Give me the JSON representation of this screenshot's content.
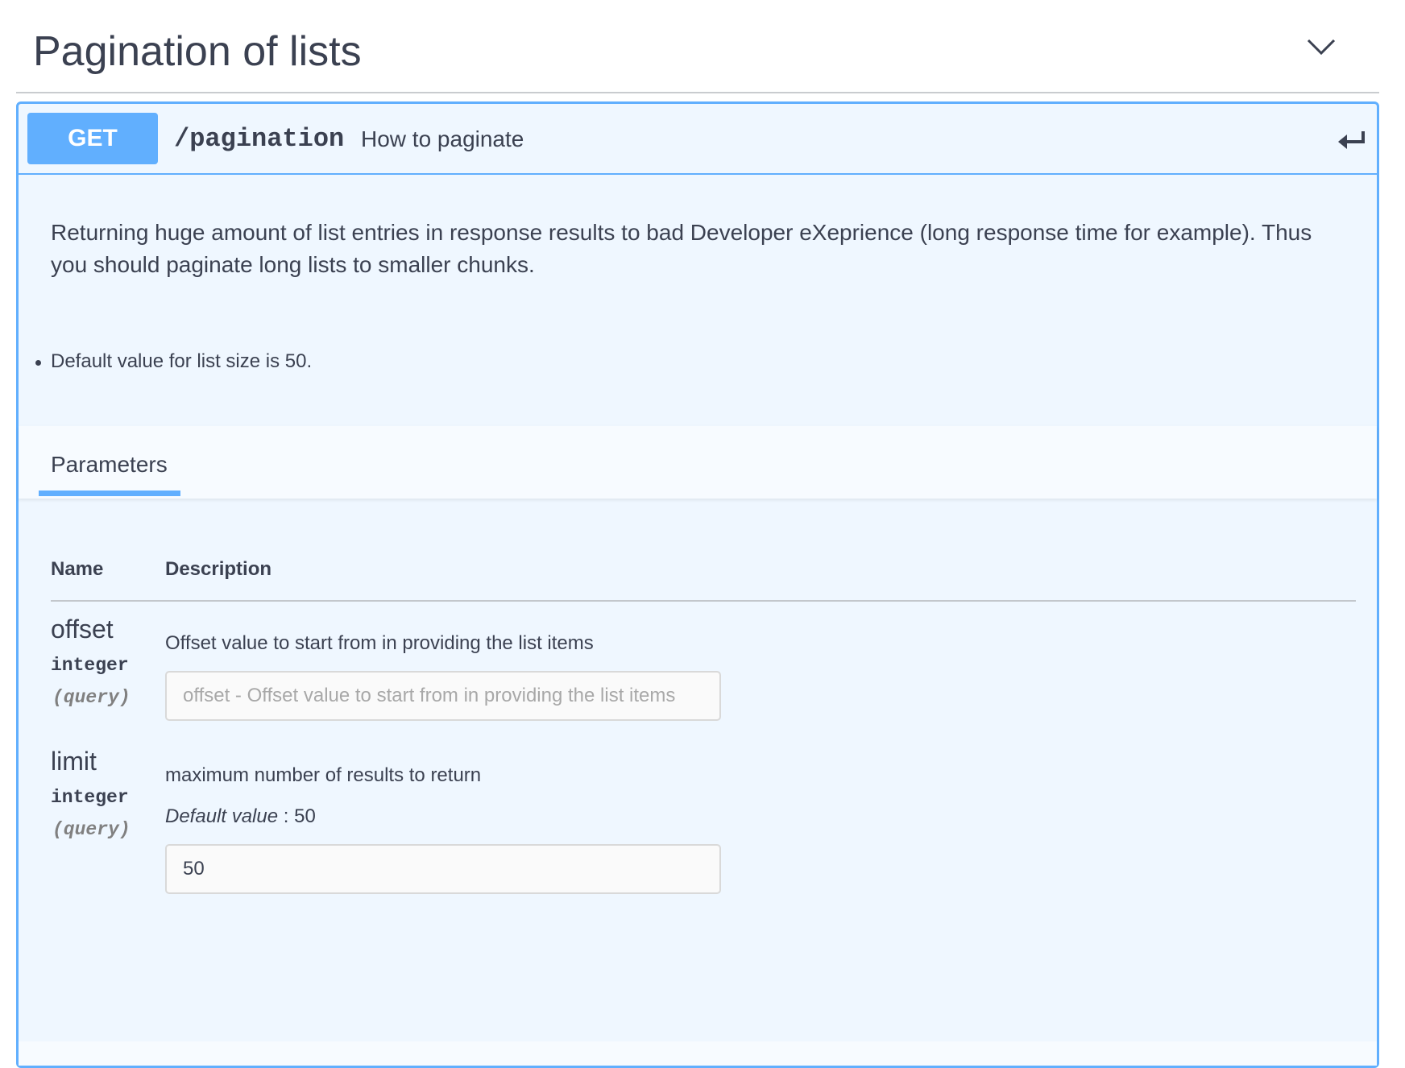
{
  "section": {
    "title": "Pagination of lists"
  },
  "operation": {
    "method": "GET",
    "path": "/pagination",
    "summary": "How to paginate",
    "description": "Returning huge amount of list entries in response results to bad Developer eXeprience (long response time for example). Thus you should paginate long lists to smaller chunks.",
    "notes": [
      "Default value for list size is 50."
    ]
  },
  "tabs": {
    "parameters_label": "Parameters"
  },
  "table": {
    "col_name": "Name",
    "col_description": "Description"
  },
  "params": [
    {
      "name": "offset",
      "type": "integer",
      "in": "(query)",
      "description": "Offset value to start from in providing the list items",
      "placeholder": "offset - Offset value to start from in providing the list items",
      "value": ""
    },
    {
      "name": "limit",
      "type": "integer",
      "in": "(query)",
      "description": "maximum number of results to return",
      "default_label": "Default value",
      "default_sep": " : ",
      "default_value": "50",
      "placeholder": "",
      "value": "50"
    }
  ],
  "colors": {
    "get_accent": "#61affe",
    "block_bg": "#eff7ff",
    "text": "#3b4151"
  },
  "icons": {
    "collapse": "chevron-down-icon",
    "return": "return-arrow-icon"
  }
}
